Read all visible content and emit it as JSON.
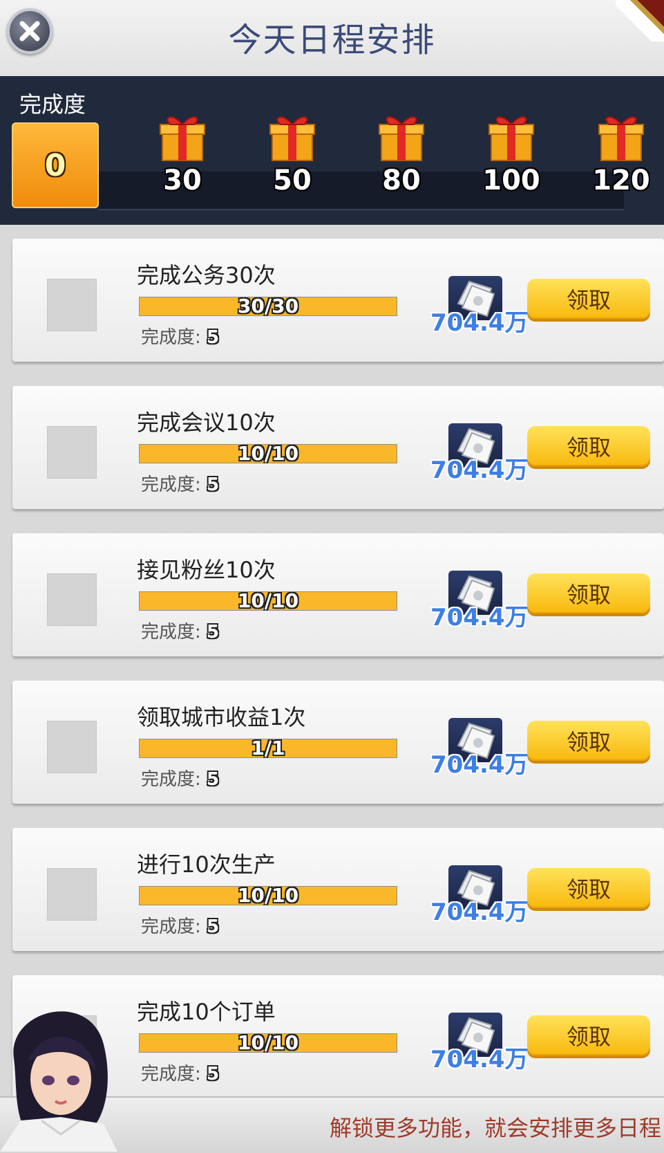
{
  "header": {
    "title": "今天日程安排",
    "close_icon": "close-icon"
  },
  "progress": {
    "label": "完成度",
    "current": "0",
    "milestones": [
      {
        "value": "30",
        "icon": "gift-icon"
      },
      {
        "value": "50",
        "icon": "gift-icon"
      },
      {
        "value": "80",
        "icon": "gift-icon"
      },
      {
        "value": "100",
        "icon": "gift-icon"
      },
      {
        "value": "120",
        "icon": "gift-icon"
      }
    ]
  },
  "tasks": [
    {
      "name": "完成公务30次",
      "progress_text": "30/30",
      "progress_fraction": 1.0,
      "points_label": "完成度:",
      "points": "5",
      "reward": "704.4万",
      "reward_icon": "money-icon",
      "button": "领取"
    },
    {
      "name": "完成会议10次",
      "progress_text": "10/10",
      "progress_fraction": 1.0,
      "points_label": "完成度:",
      "points": "5",
      "reward": "704.4万",
      "reward_icon": "money-icon",
      "button": "领取"
    },
    {
      "name": "接见粉丝10次",
      "progress_text": "10/10",
      "progress_fraction": 1.0,
      "points_label": "完成度:",
      "points": "5",
      "reward": "704.4万",
      "reward_icon": "money-icon",
      "button": "领取"
    },
    {
      "name": "领取城市收益1次",
      "progress_text": "1/1",
      "progress_fraction": 1.0,
      "points_label": "完成度:",
      "points": "5",
      "reward": "704.4万",
      "reward_icon": "money-icon",
      "button": "领取"
    },
    {
      "name": "进行10次生产",
      "progress_text": "10/10",
      "progress_fraction": 1.0,
      "points_label": "完成度:",
      "points": "5",
      "reward": "704.4万",
      "reward_icon": "money-icon",
      "button": "领取"
    },
    {
      "name": "完成10个订单",
      "progress_text": "10/10",
      "progress_fraction": 1.0,
      "points_label": "完成度:",
      "points": "5",
      "reward": "704.4万",
      "reward_icon": "money-icon",
      "button": "领取"
    }
  ],
  "footer": {
    "message": "解锁更多功能，就会安排更多日程"
  },
  "colors": {
    "panel_dark": "#212a3d",
    "bar_fill": "#fbb72a",
    "button_yellow": "#f8b80c",
    "reward_blue": "#3d7fe4",
    "title_blue": "#3b4b78",
    "footer_red": "#a03a2a"
  }
}
